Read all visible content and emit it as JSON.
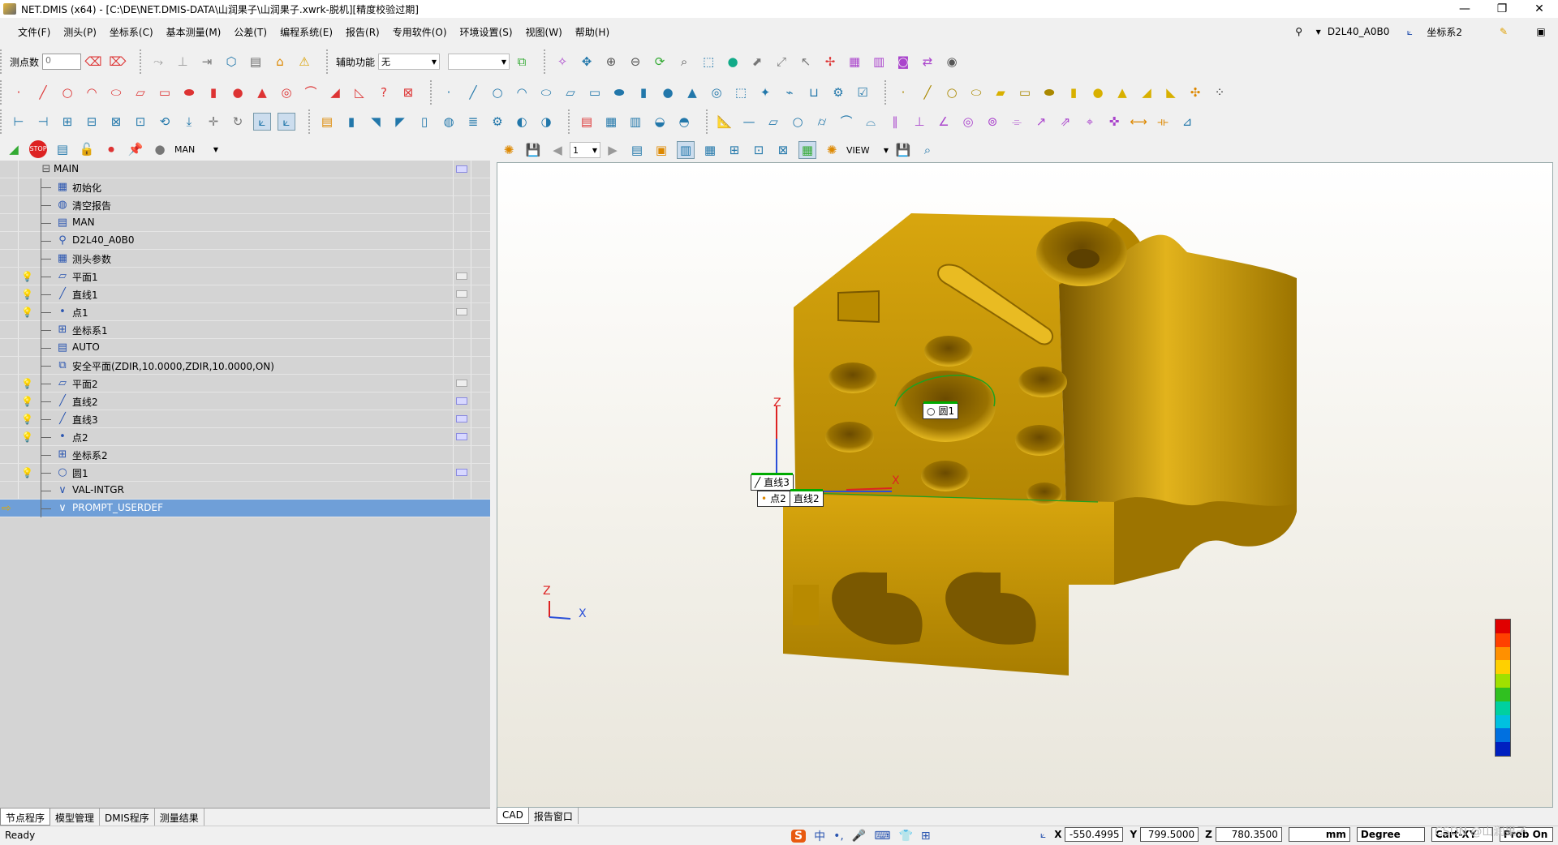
{
  "window": {
    "title": "NET.DMIS (x64) - [C:\\DE\\NET.DMIS-DATA\\山润果子\\山润果子.xwrk-脱机][精度校验过期]",
    "controls": [
      "—",
      "❐",
      "✕"
    ]
  },
  "menu": {
    "items": [
      "文件(F)",
      "测头(P)",
      "坐标系(C)",
      "基本测量(M)",
      "公差(T)",
      "编程系统(E)",
      "报告(R)",
      "专用软件(O)",
      "环境设置(S)",
      "视图(W)",
      "帮助(H)"
    ],
    "probe_name": "D2L40_A0B0",
    "coord_system": "坐标系2"
  },
  "toolbar": {
    "points_label": "测点数",
    "points_value": "0",
    "aux_label": "辅助功能",
    "aux_value": "无",
    "mode_value": "MAN"
  },
  "tree": {
    "rows": [
      {
        "label": "MAIN",
        "icon": "minus-box",
        "lamp": "none",
        "flag": "purple"
      },
      {
        "label": "初始化",
        "icon": "init-icon",
        "lamp": "none",
        "flag": "none"
      },
      {
        "label": "清空报告",
        "icon": "report-clear-icon",
        "lamp": "none",
        "flag": "none"
      },
      {
        "label": "MAN",
        "icon": "mode-icon",
        "lamp": "none",
        "flag": "none"
      },
      {
        "label": "D2L40_A0B0",
        "icon": "probe-icon",
        "lamp": "none",
        "flag": "none"
      },
      {
        "label": "测头参数",
        "icon": "probe-param-icon",
        "lamp": "none",
        "flag": "none"
      },
      {
        "label": "平面1",
        "icon": "plane-icon",
        "lamp": "gray",
        "flag": "dim"
      },
      {
        "label": "直线1",
        "icon": "line-icon",
        "lamp": "gray",
        "flag": "dim"
      },
      {
        "label": "点1",
        "icon": "point-icon",
        "lamp": "gray",
        "flag": "dim"
      },
      {
        "label": "坐标系1",
        "icon": "csys-icon",
        "lamp": "none",
        "flag": "none"
      },
      {
        "label": "AUTO",
        "icon": "mode-icon",
        "lamp": "none",
        "flag": "none"
      },
      {
        "label": "安全平面(ZDIR,10.0000,ZDIR,10.0000,ON)",
        "icon": "safe-plane-icon",
        "lamp": "none",
        "flag": "none"
      },
      {
        "label": "平面2",
        "icon": "plane-icon",
        "lamp": "gray",
        "flag": "dim"
      },
      {
        "label": "直线2",
        "icon": "line-icon",
        "lamp": "red",
        "flag": "purple"
      },
      {
        "label": "直线3",
        "icon": "line-icon",
        "lamp": "red",
        "flag": "purple"
      },
      {
        "label": "点2",
        "icon": "point-icon",
        "lamp": "red",
        "flag": "purple"
      },
      {
        "label": "坐标系2",
        "icon": "csys-icon",
        "lamp": "none",
        "flag": "none"
      },
      {
        "label": "圆1",
        "icon": "circle-icon",
        "lamp": "red",
        "flag": "purple"
      },
      {
        "label": "VAL-INTGR",
        "icon": "val-icon",
        "lamp": "none",
        "flag": "none"
      },
      {
        "label": "PROMPT_USERDEF",
        "icon": "val-icon",
        "lamp": "arrow",
        "flag": "none",
        "selected": true
      }
    ]
  },
  "left_tabs": [
    "节点程序",
    "模型管理",
    "DMIS程序",
    "测量结果"
  ],
  "view": {
    "toolbar_page": "1",
    "toolbar_view": "VIEW",
    "callouts": {
      "circle": "圆1",
      "line3": "直线3",
      "line2": "直线2",
      "point2": "点2"
    },
    "axis_labels": {
      "z": "Z",
      "x": "X"
    }
  },
  "view_tabs": [
    "CAD",
    "报告窗口"
  ],
  "status": {
    "ready": "Ready",
    "x_label": "X",
    "x_value": "-550.4995",
    "y_label": "Y",
    "y_value": "799.5000",
    "z_label": "Z",
    "z_value": "780.3500",
    "unit": "mm",
    "angle": "Degree",
    "cart": "Cart-XY",
    "probe": "Prob On",
    "watermark": "CSDN @山润果子"
  },
  "colors": {
    "part": "#c89600",
    "part_dark": "#8a6500",
    "selection": "#6f9fd8"
  }
}
